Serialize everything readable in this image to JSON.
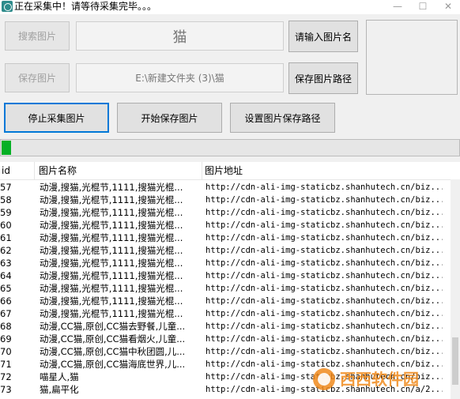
{
  "window": {
    "title": "正在采集中！请等待采集完毕。。。"
  },
  "toolbar": {
    "search_button": "搜索图片",
    "search_value": "猫",
    "enter_name_button": "请输入图片名",
    "save_button": "保存图片",
    "path_value": "E:\\新建文件夹 (3)\\猫",
    "save_path_button": "保存图片路径",
    "stop_button": "停止采集图片",
    "start_save_button": "开始保存图片",
    "set_path_button": "设置图片保存路径"
  },
  "progress": {
    "fraction": 0.021
  },
  "list": {
    "columns": [
      "id",
      "图片名称",
      "图片地址"
    ],
    "rows": [
      [
        "57",
        "动漫,搜猫,光棍节,1111,搜猫光棍...",
        "http://cdn-ali-img-staticbz.shanhutech.cn/biz..."
      ],
      [
        "58",
        "动漫,搜猫,光棍节,1111,搜猫光棍...",
        "http://cdn-ali-img-staticbz.shanhutech.cn/biz..."
      ],
      [
        "59",
        "动漫,搜猫,光棍节,1111,搜猫光棍...",
        "http://cdn-ali-img-staticbz.shanhutech.cn/biz..."
      ],
      [
        "60",
        "动漫,搜猫,光棍节,1111,搜猫光棍...",
        "http://cdn-ali-img-staticbz.shanhutech.cn/biz..."
      ],
      [
        "61",
        "动漫,搜猫,光棍节,1111,搜猫光棍...",
        "http://cdn-ali-img-staticbz.shanhutech.cn/biz..."
      ],
      [
        "62",
        "动漫,搜猫,光棍节,1111,搜猫光棍...",
        "http://cdn-ali-img-staticbz.shanhutech.cn/biz..."
      ],
      [
        "63",
        "动漫,搜猫,光棍节,1111,搜猫光棍...",
        "http://cdn-ali-img-staticbz.shanhutech.cn/biz..."
      ],
      [
        "64",
        "动漫,搜猫,光棍节,1111,搜猫光棍...",
        "http://cdn-ali-img-staticbz.shanhutech.cn/biz..."
      ],
      [
        "65",
        "动漫,搜猫,光棍节,1111,搜猫光棍...",
        "http://cdn-ali-img-staticbz.shanhutech.cn/biz..."
      ],
      [
        "66",
        "动漫,搜猫,光棍节,1111,搜猫光棍...",
        "http://cdn-ali-img-staticbz.shanhutech.cn/biz..."
      ],
      [
        "67",
        "动漫,搜猫,光棍节,1111,搜猫光棍...",
        "http://cdn-ali-img-staticbz.shanhutech.cn/biz..."
      ],
      [
        "68",
        "动漫,CC猫,原创,CC猫去野餐,儿童...",
        "http://cdn-ali-img-staticbz.shanhutech.cn/biz..."
      ],
      [
        "69",
        "动漫,CC猫,原创,CC猫看烟火,儿童...",
        "http://cdn-ali-img-staticbz.shanhutech.cn/biz..."
      ],
      [
        "70",
        "动漫,CC猫,原创,CC猫中秋团圆,儿...",
        "http://cdn-ali-img-staticbz.shanhutech.cn/biz..."
      ],
      [
        "71",
        "动漫,CC猫,原创,CC猫海底世界,儿...",
        "http://cdn-ali-img-staticbz.shanhutech.cn/biz..."
      ],
      [
        "72",
        "喵星人,猫",
        "http://cdn-ali-img-staticbz.shanhutech.cn/biz..."
      ],
      [
        "73",
        "猫,扁平化",
        "http://cdn-ali-img-staticbz.shanhutech.cn/a/2..."
      ]
    ]
  },
  "watermark": {
    "text": "西西软件园"
  },
  "colors": {
    "progress_green": "#06b025",
    "focus_blue": "#0078d7"
  }
}
